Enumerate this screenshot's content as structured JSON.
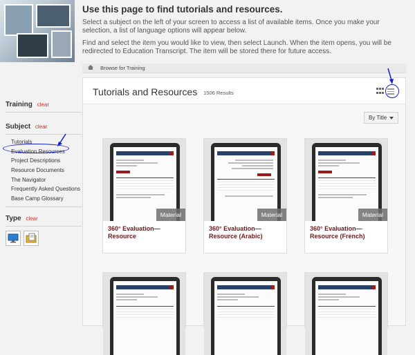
{
  "intro": {
    "heading": "Use this page to find tutorials and resources.",
    "para1": "Select a subject on the left of your screen to access a list of available items. Once you make your selection, a list of language options will appear below.",
    "para2": "Find and select the item you would like to view, then select Launch. When the item opens, you will be redirected to Education Transcript. The item will be stored there for future access."
  },
  "sidebar": {
    "training": {
      "title": "Training",
      "clear": "clear"
    },
    "subject": {
      "title": "Subject",
      "clear": "clear",
      "items": [
        "Tutorials",
        "Evaluation Resources",
        "Project Descriptions",
        "Resource Documents",
        "The Navigator",
        "Frequently Asked Questions",
        "Base Camp Glossary"
      ]
    },
    "type": {
      "title": "Type",
      "clear": "clear",
      "icons": [
        "monitor-icon",
        "folder-document-icon"
      ]
    }
  },
  "breadcrumb": {
    "label": "Browse for Training"
  },
  "results": {
    "title": "Tutorials and Resources",
    "count": "1506 Results",
    "sort_label": "By Title",
    "cards": [
      {
        "title": "360° Evaluation—Resource",
        "badge": "Material"
      },
      {
        "title": "360° Evaluation—Resource (Arabic)",
        "badge": "Material"
      },
      {
        "title": "360° Evaluation—Resource (French)",
        "badge": "Material"
      }
    ]
  },
  "colors": {
    "accent": "#6d1a1a",
    "annotation": "#1420c8",
    "clear_link": "#c0392b"
  }
}
